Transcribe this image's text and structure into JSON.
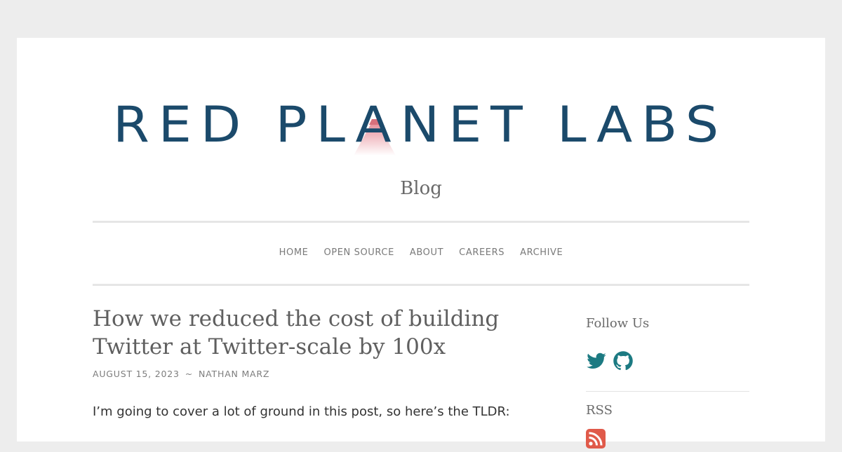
{
  "site": {
    "logo_text": "RED PLANET LABS",
    "subtitle": "Blog"
  },
  "nav": {
    "items": [
      {
        "label": "HOME"
      },
      {
        "label": "OPEN SOURCE"
      },
      {
        "label": "ABOUT"
      },
      {
        "label": "CAREERS"
      },
      {
        "label": "ARCHIVE"
      }
    ]
  },
  "post": {
    "title": "How we reduced the cost of building Twitter at Twitter-scale by 100x",
    "date": "AUGUST 15, 2023",
    "separator": "~",
    "author": "NATHAN MARZ",
    "intro": "I’m going to cover a lot of ground in this post, so here’s the TLDR:"
  },
  "sidebar": {
    "follow_title": "Follow Us",
    "social_icons": [
      "twitter-icon",
      "github-icon"
    ],
    "rss_title": "RSS",
    "rss_icon": "rss-icon"
  },
  "colors": {
    "logo_blue": "#1b4a6b",
    "accent_teal": "#1c7a82",
    "rss_red": "#e05a4a"
  }
}
